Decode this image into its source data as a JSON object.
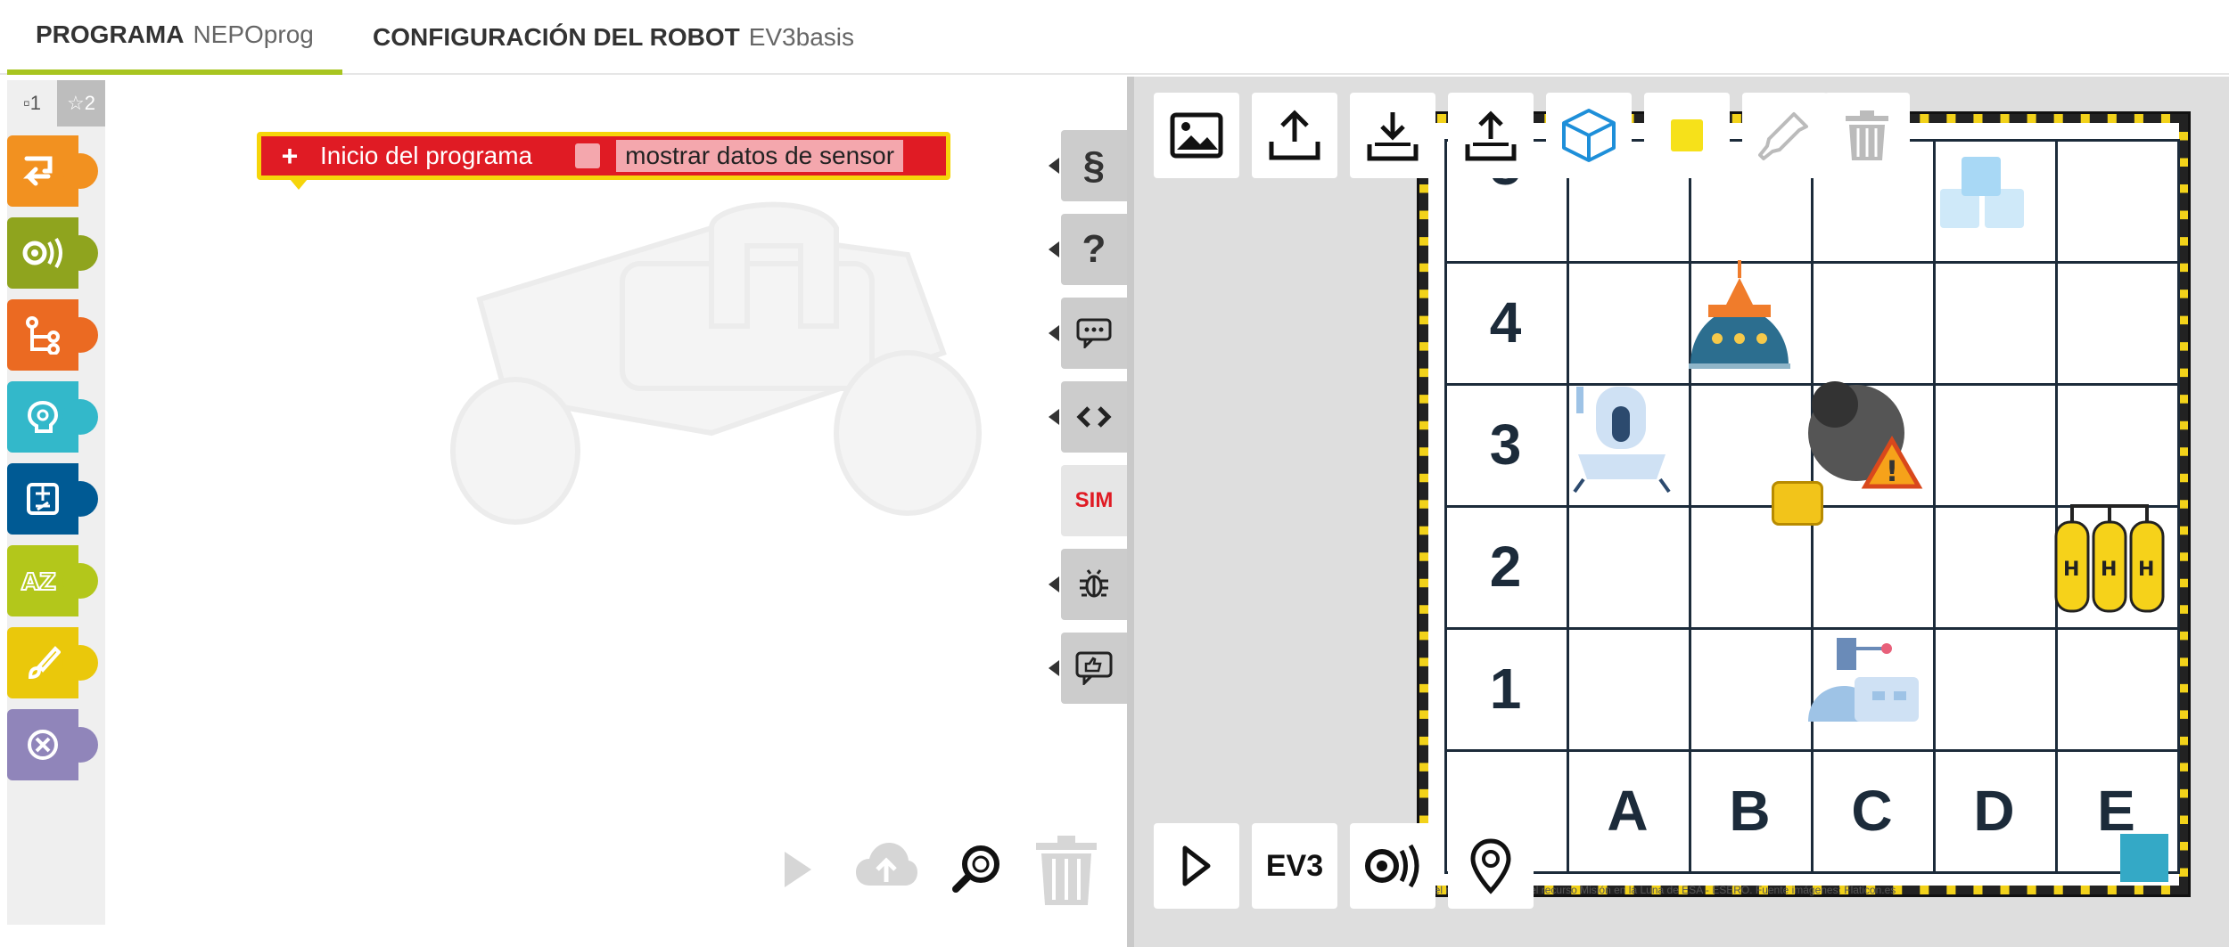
{
  "tabs": {
    "program_label": "PROGRAMA",
    "program_value": "NEPOprog",
    "config_label": "CONFIGURACIÓN DEL ROBOT",
    "config_value": "EV3basis"
  },
  "toolbox": {
    "level1": "▫1",
    "level2": "☆2",
    "categories": [
      {
        "name": "action",
        "icon": "action-icon",
        "color": "#f29120"
      },
      {
        "name": "sensors",
        "icon": "sensor-icon",
        "color": "#8fa41e"
      },
      {
        "name": "control",
        "icon": "control-icon",
        "color": "#eb6a22"
      },
      {
        "name": "logic",
        "icon": "logic-icon",
        "color": "#33b8ca"
      },
      {
        "name": "math",
        "icon": "math-icon",
        "color": "#005a94"
      },
      {
        "name": "text",
        "icon": "text-icon",
        "color": "#b3c71b"
      },
      {
        "name": "colour",
        "icon": "brush-icon",
        "color": "#eac80b"
      },
      {
        "name": "variables",
        "icon": "variable-icon",
        "color": "#9085ba"
      }
    ]
  },
  "program": {
    "start_label": "Inicio del programa",
    "sensor_label": "mostrar datos de sensor",
    "plus": "+"
  },
  "side_buttons": {
    "code": "§",
    "help": "?",
    "comment": "comment-icon",
    "source": "code-icon",
    "sim": "SIM",
    "debug": "bug-icon",
    "feedback": "thumbs-up-icon"
  },
  "board": {
    "rows": [
      "5",
      "4",
      "3",
      "2",
      "1"
    ],
    "columns": [
      "A",
      "B",
      "C",
      "D",
      "E"
    ],
    "credit": "del robot. Basado en el recurso Misión en la Luna de ESA - ESERO. Fuente imágenes: Flaticon.es"
  },
  "sim_bottom": {
    "ev3": "EV3"
  },
  "colors": {
    "accent_green": "#a8c520",
    "start_red": "#e01b24",
    "yellow": "#f6d50a",
    "grid_dark": "#1c2b3a",
    "sim_bg": "#dedede"
  }
}
